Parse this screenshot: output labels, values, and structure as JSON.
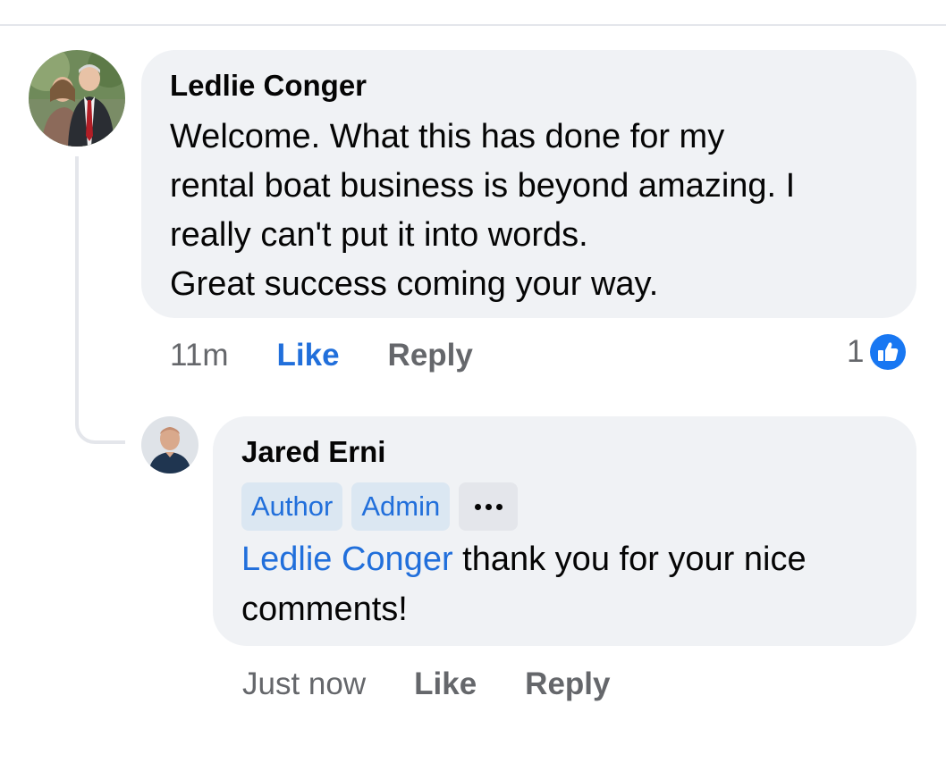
{
  "comments": [
    {
      "author": "Ledlie Conger",
      "text": "Welcome. What this has done for my\nrental boat business is beyond amazing. I\nreally can't put it into words.\nGreat success coming your way.",
      "time": "11m",
      "like_label": "Like",
      "reply_label": "Reply",
      "reaction_count": "1"
    },
    {
      "author": "Jared Erni",
      "badges": [
        "Author",
        "Admin"
      ],
      "mention": "Ledlie Conger",
      "text": " thank you for your nice\ncomments!",
      "time": "Just now",
      "like_label": "Like",
      "reply_label": "Reply"
    }
  ],
  "colors": {
    "accent": "#216fdb",
    "bubble": "#f0f2f5",
    "muted_text": "#65676b"
  },
  "icons": [
    "like-reaction-icon",
    "more-options-icon"
  ]
}
